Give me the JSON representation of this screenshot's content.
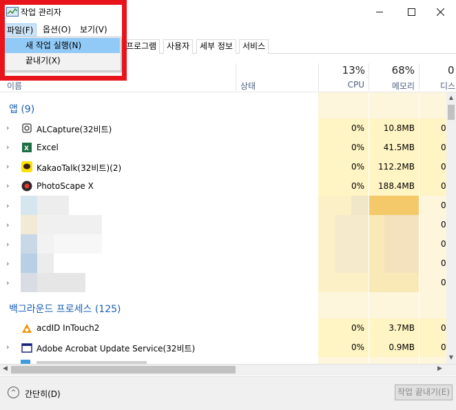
{
  "window": {
    "title": "작업 관리자"
  },
  "menu": [
    {
      "label": "파일(F)",
      "active": true
    },
    {
      "label": "옵션(O)",
      "active": false
    },
    {
      "label": "보기(V)",
      "active": false
    }
  ],
  "dropdown": [
    {
      "label": "새 작업 실행(N)",
      "highlighted": true
    },
    {
      "label": "끝내기(X)",
      "highlighted": false
    }
  ],
  "tabs": [
    "프로그램",
    "사용자",
    "세부 정보",
    "서비스"
  ],
  "header": {
    "name": "이름",
    "status": "상태",
    "cpu": {
      "pct": "13%",
      "label": "CPU"
    },
    "memory": {
      "pct": "68%",
      "label": "메모리"
    },
    "disk": {
      "pct": "0",
      "label": "디스"
    }
  },
  "groups": {
    "apps": "앱 (9)",
    "background": "백그라운드 프로세스 (125)"
  },
  "apps": [
    {
      "name": "ALCapture(32비트)",
      "cpu": "0%",
      "memory": "10.8MB",
      "disk": "0",
      "icon": "alcapture-icon"
    },
    {
      "name": "Excel",
      "cpu": "0%",
      "memory": "41.5MB",
      "disk": "0",
      "icon": "excel-icon"
    },
    {
      "name": "KakaoTalk(32비트)(2)",
      "cpu": "0%",
      "memory": "112.2MB",
      "disk": "0",
      "icon": "kakaotalk-icon"
    },
    {
      "name": "PhotoScape X",
      "cpu": "0%",
      "memory": "188.4MB",
      "disk": "0",
      "icon": "photoscape-icon"
    }
  ],
  "blurred_rows_disk": [
    "0",
    "0",
    "0",
    "0",
    "0"
  ],
  "background": [
    {
      "name": "acdID InTouch2",
      "cpu": "0%",
      "memory": "3.7MB",
      "disk": "0",
      "icon": "acdid-icon",
      "expandable": false
    },
    {
      "name": "Adobe Acrobat Update Service(32비트)",
      "cpu": "0%",
      "memory": "0.9MB",
      "disk": "0",
      "icon": "acrobat-update-icon",
      "expandable": true
    }
  ],
  "footer": {
    "collapse": "간단히(D)",
    "end_task": "작업 끝내기(E)"
  },
  "colors": {
    "highlight_red": "#e8141c",
    "menu_active": "#cce4f7",
    "dropdown_highlight": "#91c9f7",
    "group_blue": "#1a5fb4",
    "metric_bg": "#fff4c4"
  }
}
